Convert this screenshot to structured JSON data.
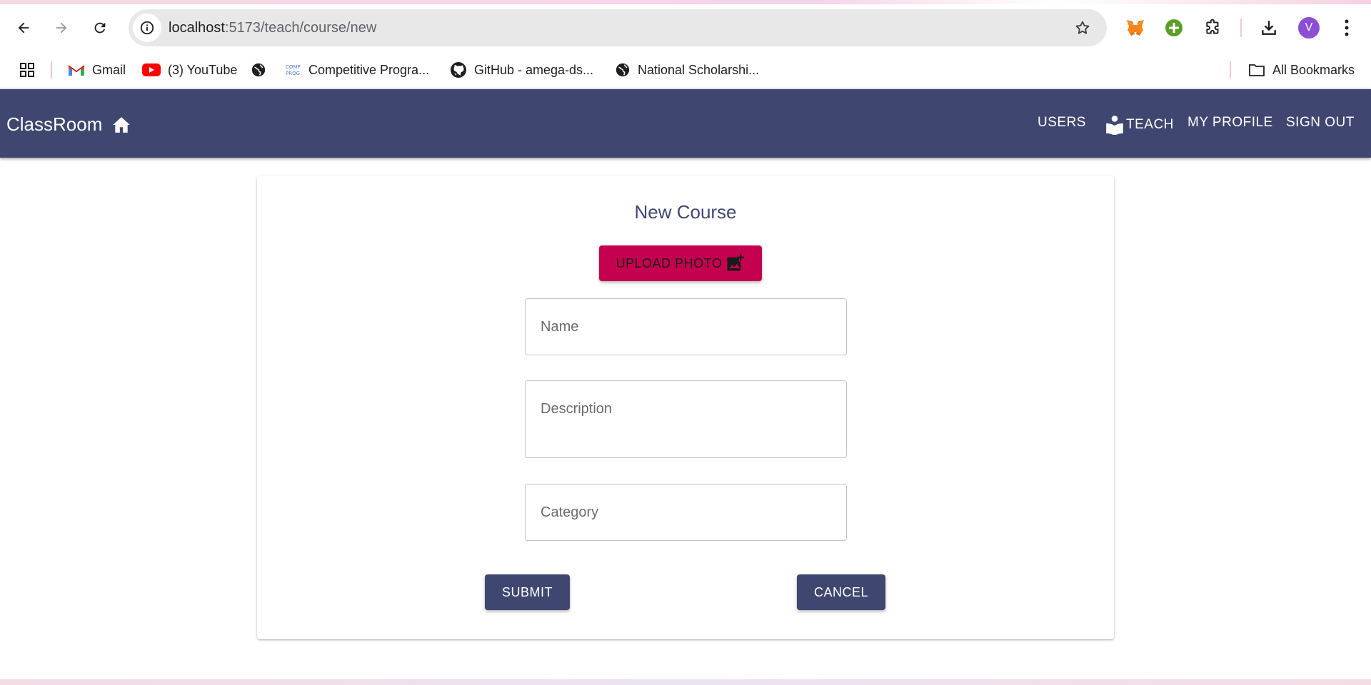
{
  "browser": {
    "url_host": "localhost",
    "url_path": ":5173/teach/course/new",
    "profile_initial": "V"
  },
  "bookmarks": {
    "items": [
      {
        "label": "Gmail",
        "icon": "gmail-icon"
      },
      {
        "label": "(3) YouTube",
        "icon": "youtube-icon"
      },
      {
        "label": "",
        "icon": "globe-icon"
      },
      {
        "label": "Competitive Progra...",
        "icon": "comp-prog-icon"
      },
      {
        "label": "GitHub - amega-ds...",
        "icon": "github-icon"
      },
      {
        "label": "National Scholarshi...",
        "icon": "globe-icon"
      }
    ],
    "all_bookmarks": "All Bookmarks"
  },
  "app": {
    "brand": "ClassRoom",
    "nav": {
      "users": "USERS",
      "teach": "TEACH",
      "my_profile": "MY PROFILE",
      "sign_out": "SIGN OUT"
    },
    "colors": {
      "primary": "#3f4771",
      "accent": "#c5004e"
    }
  },
  "form": {
    "title": "New Course",
    "upload_label": "UPLOAD PHOTO",
    "name_placeholder": "Name",
    "description_placeholder": "Description",
    "category_placeholder": "Category",
    "submit_label": "SUBMIT",
    "cancel_label": "CANCEL"
  }
}
